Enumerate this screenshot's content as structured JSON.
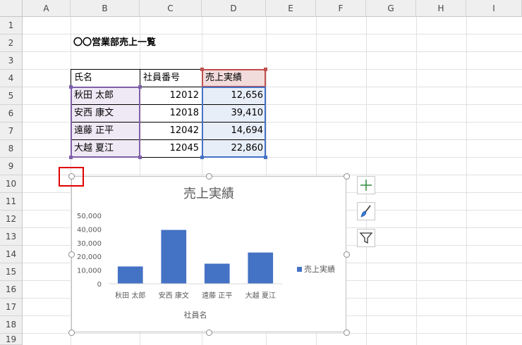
{
  "columns": [
    "A",
    "B",
    "C",
    "D",
    "E",
    "F",
    "G",
    "H",
    "I"
  ],
  "rows": [
    "1",
    "2",
    "3",
    "4",
    "5",
    "6",
    "7",
    "8",
    "9",
    "10",
    "11",
    "12",
    "13",
    "14",
    "15",
    "16",
    "17",
    "18",
    "19"
  ],
  "sheet_title": "〇〇営業部売上一覧",
  "table": {
    "headers": [
      "氏名",
      "社員番号",
      "売上実績"
    ],
    "rows": [
      {
        "name": "秋田 太郎",
        "id": "12012",
        "sales": "12,656"
      },
      {
        "name": "安西 康文",
        "id": "12018",
        "sales": "39,410"
      },
      {
        "name": "遠藤 正平",
        "id": "12042",
        "sales": "14,694"
      },
      {
        "name": "大越 夏江",
        "id": "12045",
        "sales": "22,860"
      }
    ]
  },
  "chart_data": {
    "type": "bar",
    "title": "売上実績",
    "xlabel": "社員名",
    "ylabel": "",
    "categories": [
      "秋田 太郎",
      "安西 康文",
      "遠藤 正平",
      "大越 夏江"
    ],
    "series": [
      {
        "name": "売上実績",
        "values": [
          12656,
          39410,
          14694,
          22860
        ],
        "color": "#4472c4"
      }
    ],
    "ylim": [
      0,
      50000
    ],
    "yticks": [
      "0",
      "10,000",
      "20,000",
      "30,000",
      "40,000",
      "50,000"
    ],
    "legend": "right",
    "grid": false
  },
  "colors": {
    "accent": "#4472c4",
    "selection_red": "#e00000",
    "ref_purple": "#7f5fa8",
    "ref_red": "#c0504d",
    "ref_blue": "#4472c4"
  },
  "side_buttons": [
    "plus-icon",
    "brush-icon",
    "filter-icon"
  ]
}
